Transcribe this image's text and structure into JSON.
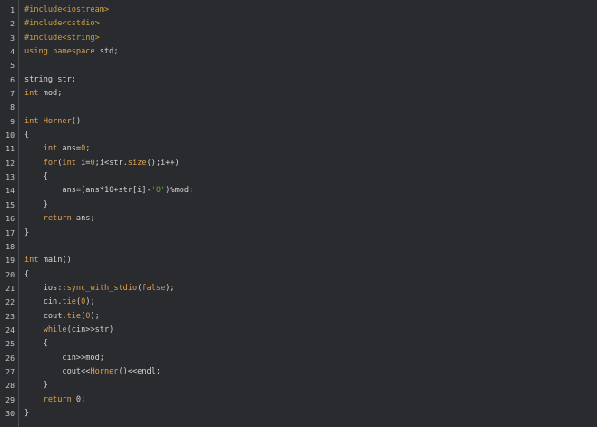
{
  "editor": {
    "lines": [
      {
        "n": "1",
        "t": "#include<iostream>"
      },
      {
        "n": "2",
        "t": "#include<cstdio>"
      },
      {
        "n": "3",
        "t": "#include<string>"
      },
      {
        "n": "4",
        "t": "using namespace std;"
      },
      {
        "n": "5",
        "t": ""
      },
      {
        "n": "6",
        "t": "string str;"
      },
      {
        "n": "7",
        "t": "int mod;"
      },
      {
        "n": "8",
        "t": ""
      },
      {
        "n": "9",
        "t": "int Horner()"
      },
      {
        "n": "10",
        "t": "{"
      },
      {
        "n": "11",
        "t": "    int ans=0;"
      },
      {
        "n": "12",
        "t": "    for(int i=0;i<str.size();i++)"
      },
      {
        "n": "13",
        "t": "    {"
      },
      {
        "n": "14",
        "t": "        ans=(ans*10+str[i]-'0')%mod;"
      },
      {
        "n": "15",
        "t": "    }"
      },
      {
        "n": "16",
        "t": "    return ans;"
      },
      {
        "n": "17",
        "t": "}"
      },
      {
        "n": "18",
        "t": ""
      },
      {
        "n": "19",
        "t": "int main()"
      },
      {
        "n": "20",
        "t": "{"
      },
      {
        "n": "21",
        "t": "    ios::sync_with_stdio(false);"
      },
      {
        "n": "22",
        "t": "    cin.tie(0);"
      },
      {
        "n": "23",
        "t": "    cout.tie(0);"
      },
      {
        "n": "24",
        "t": "    while(cin>>str)"
      },
      {
        "n": "25",
        "t": "    {"
      },
      {
        "n": "26",
        "t": "        cin>>mod;"
      },
      {
        "n": "27",
        "t": "        cout<<Horner()<<endl;"
      },
      {
        "n": "28",
        "t": "    }"
      },
      {
        "n": "29",
        "t": "    return 0;"
      },
      {
        "n": "30",
        "t": "}"
      }
    ]
  },
  "colors": {
    "background": "#2a2b2e",
    "text": "#d4d4d4",
    "keyword": "#e0a253",
    "number": "#d79b4a",
    "char_literal": "#6aaa3a",
    "line_number": "#c8c8c8"
  }
}
